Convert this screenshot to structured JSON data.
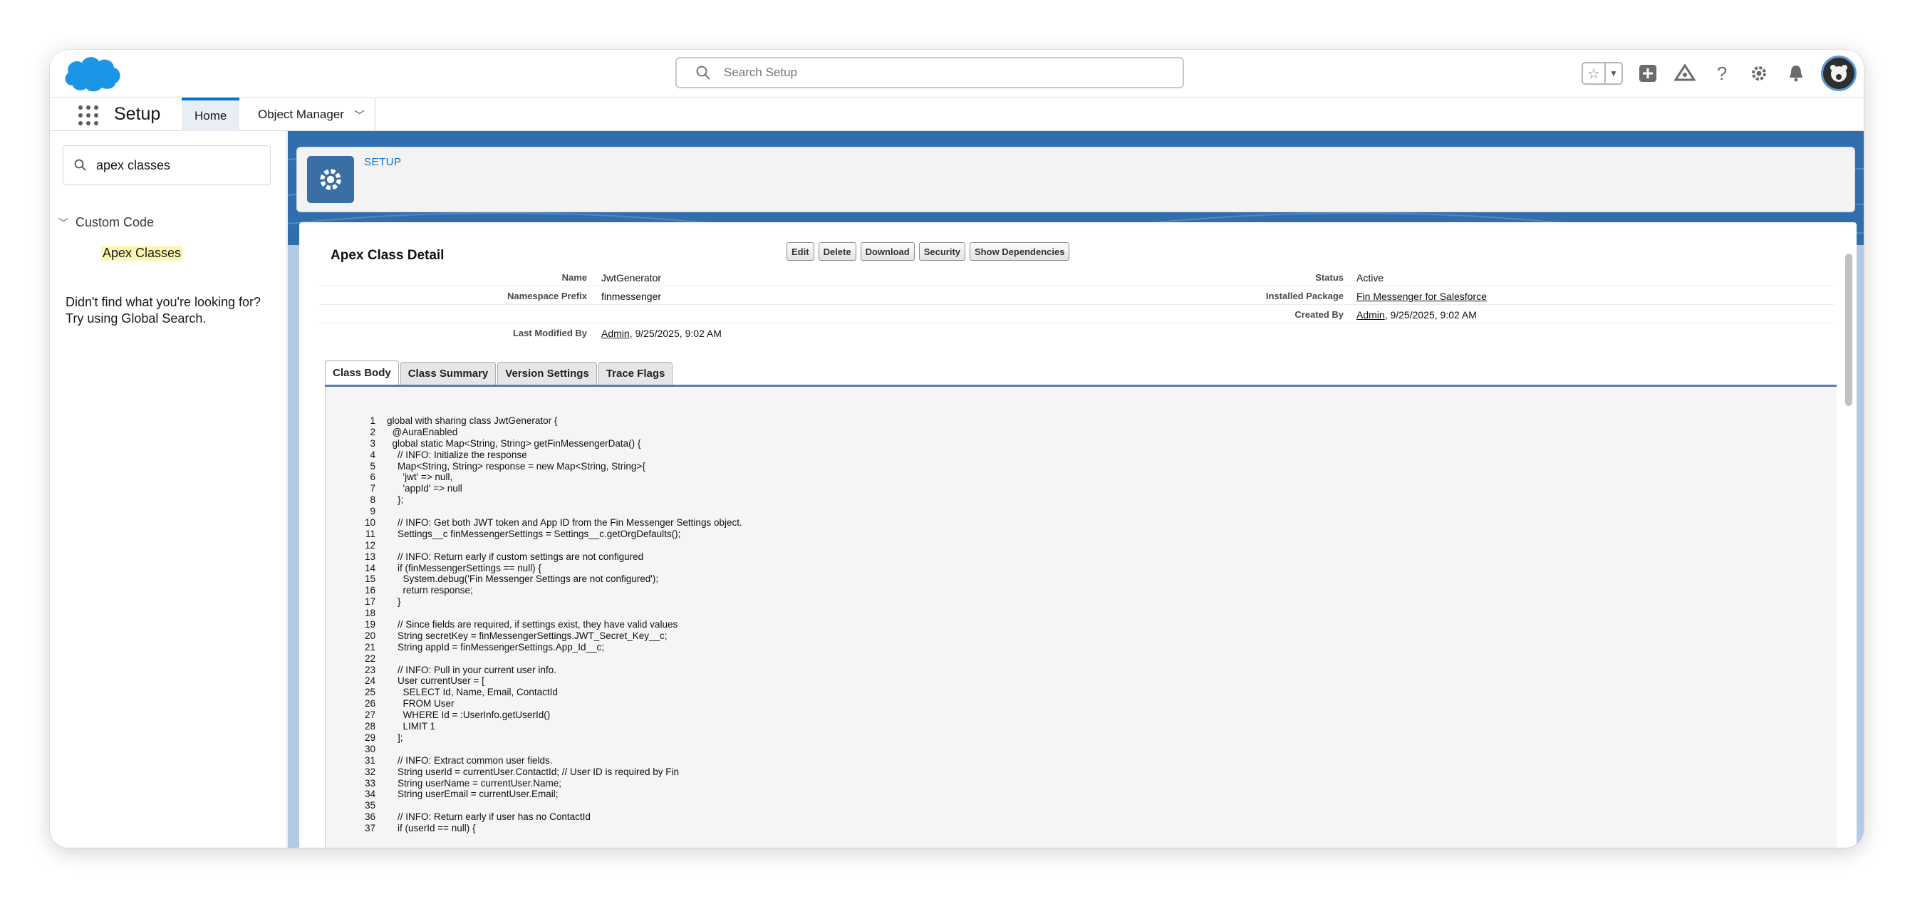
{
  "colors": {
    "brand": "#0176d3",
    "highlight": "#fcf8b3",
    "cloud": "#00a1e0"
  },
  "header": {
    "search_placeholder": "Search Setup",
    "icons": [
      "favorites-star-icon",
      "favorites-dropdown-icon",
      "global-actions-plus-icon",
      "trailhead-icon",
      "help-icon",
      "setup-gear-icon",
      "notifications-bell-icon",
      "user-avatar"
    ]
  },
  "context_bar": {
    "app_name": "Setup",
    "tabs": [
      {
        "label": "Home",
        "active": true
      },
      {
        "label": "Object Manager",
        "active": false
      }
    ]
  },
  "sidebar": {
    "quick_find_value": "apex classes",
    "section": "Custom Code",
    "item": "Apex Classes",
    "help_line1": "Didn't find what you're looking for?",
    "help_line2": "Try using Global Search."
  },
  "page_header": {
    "label": "SETUP"
  },
  "detail": {
    "title": "Apex Class Detail",
    "buttons": [
      "Edit",
      "Delete",
      "Download",
      "Security",
      "Show Dependencies"
    ],
    "fields": {
      "name_label": "Name",
      "name_value": "JwtGenerator",
      "namespace_label": "Namespace Prefix",
      "namespace_value": "finmessenger",
      "status_label": "Status",
      "status_value": "Active",
      "package_label": "Installed Package",
      "package_value": "Fin Messenger for Salesforce",
      "created_label": "Created By",
      "created_user": "Admin",
      "created_date": ", 9/25/2025, 9:02 AM",
      "modified_label": "Last Modified By",
      "modified_user": "Admin",
      "modified_date": ", 9/25/2025, 9:02 AM"
    },
    "tabs": [
      "Class Body",
      "Class Summary",
      "Version Settings",
      "Trace Flags"
    ],
    "code": [
      {
        "n": "1",
        "t": "global with sharing class JwtGenerator {"
      },
      {
        "n": "2",
        "t": "  @AuraEnabled"
      },
      {
        "n": "3",
        "t": "  global static Map<String, String> getFinMessengerData() {"
      },
      {
        "n": "4",
        "t": "    // INFO: Initialize the response"
      },
      {
        "n": "5",
        "t": "    Map<String, String> response = new Map<String, String>{"
      },
      {
        "n": "6",
        "t": "      'jwt' => null,"
      },
      {
        "n": "7",
        "t": "      'appId' => null"
      },
      {
        "n": "8",
        "t": "    };"
      },
      {
        "n": "9",
        "t": ""
      },
      {
        "n": "10",
        "t": "    // INFO: Get both JWT token and App ID from the Fin Messenger Settings object."
      },
      {
        "n": "11",
        "t": "    Settings__c finMessengerSettings = Settings__c.getOrgDefaults();"
      },
      {
        "n": "12",
        "t": ""
      },
      {
        "n": "13",
        "t": "    // INFO: Return early if custom settings are not configured"
      },
      {
        "n": "14",
        "t": "    if (finMessengerSettings == null) {"
      },
      {
        "n": "15",
        "t": "      System.debug('Fin Messenger Settings are not configured');"
      },
      {
        "n": "16",
        "t": "      return response;"
      },
      {
        "n": "17",
        "t": "    }"
      },
      {
        "n": "18",
        "t": ""
      },
      {
        "n": "19",
        "t": "    // Since fields are required, if settings exist, they have valid values"
      },
      {
        "n": "20",
        "t": "    String secretKey = finMessengerSettings.JWT_Secret_Key__c;"
      },
      {
        "n": "21",
        "t": "    String appId = finMessengerSettings.App_Id__c;"
      },
      {
        "n": "22",
        "t": ""
      },
      {
        "n": "23",
        "t": "    // INFO: Pull in your current user info."
      },
      {
        "n": "24",
        "t": "    User currentUser = ["
      },
      {
        "n": "25",
        "t": "      SELECT Id, Name, Email, ContactId"
      },
      {
        "n": "26",
        "t": "      FROM User"
      },
      {
        "n": "27",
        "t": "      WHERE Id = :UserInfo.getUserId()"
      },
      {
        "n": "28",
        "t": "      LIMIT 1"
      },
      {
        "n": "29",
        "t": "    ];"
      },
      {
        "n": "30",
        "t": ""
      },
      {
        "n": "31",
        "t": "    // INFO: Extract common user fields."
      },
      {
        "n": "32",
        "t": "    String userId = currentUser.ContactId; // User ID is required by Fin"
      },
      {
        "n": "33",
        "t": "    String userName = currentUser.Name;"
      },
      {
        "n": "34",
        "t": "    String userEmail = currentUser.Email;"
      },
      {
        "n": "35",
        "t": ""
      },
      {
        "n": "36",
        "t": "    // INFO: Return early if user has no ContactId"
      },
      {
        "n": "37",
        "t": "    if (userId == null) {"
      }
    ]
  }
}
